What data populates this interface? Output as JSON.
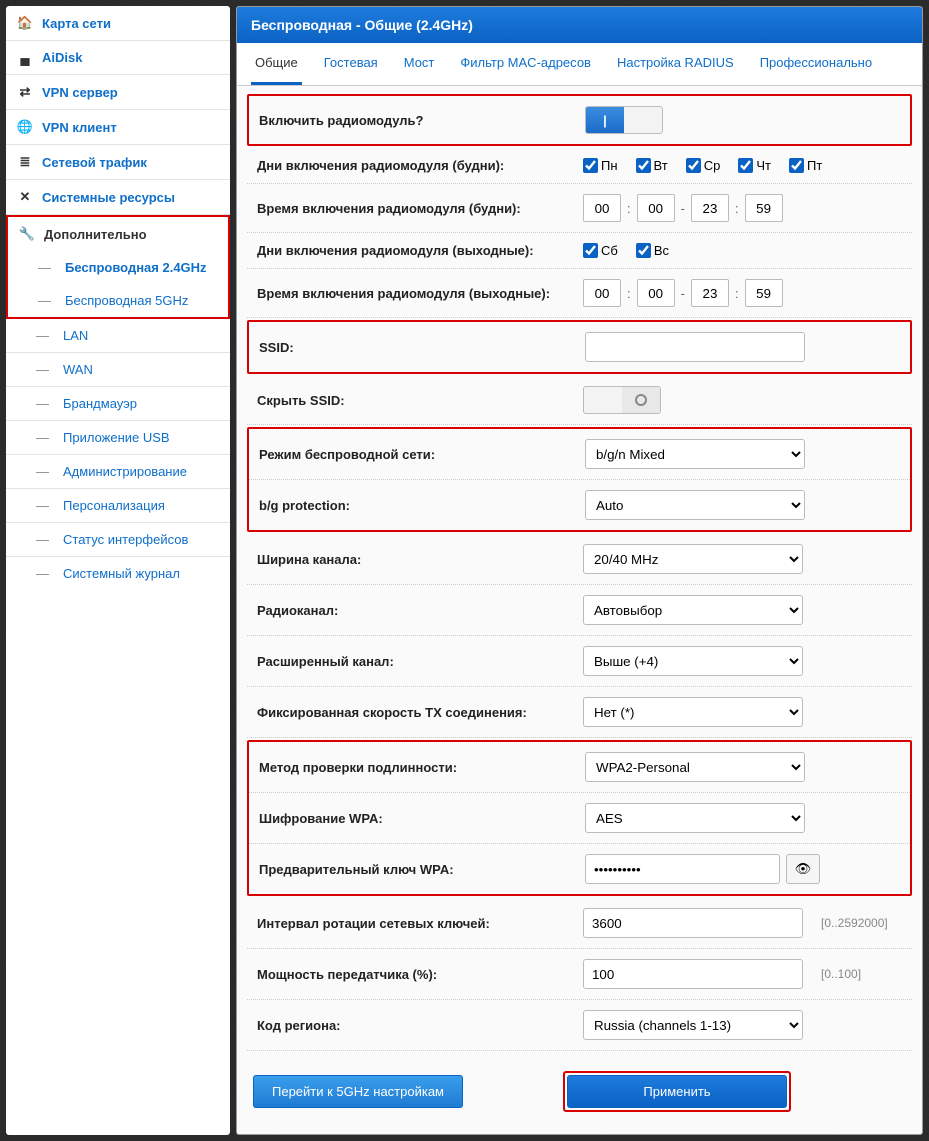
{
  "sidebar": {
    "items": [
      {
        "icon": "🏠",
        "label": "Карта сети",
        "dark": false
      },
      {
        "icon": "▄",
        "label": "AiDisk",
        "dark": false
      },
      {
        "icon": "⇄",
        "label": "VPN сервер",
        "dark": false
      },
      {
        "icon": "🌐",
        "label": "VPN клиент",
        "dark": false
      },
      {
        "icon": "≣",
        "label": "Сетевой трафик",
        "dark": false
      },
      {
        "icon": "✕",
        "label": "Системные ресурсы",
        "dark": false
      },
      {
        "icon": "🔧",
        "label": "Дополнительно",
        "dark": true
      }
    ],
    "subs": [
      {
        "label": "Беспроводная 2.4GHz",
        "bold": true
      },
      {
        "label": "Беспроводная 5GHz",
        "bold": false
      },
      {
        "label": "LAN",
        "bold": false
      },
      {
        "label": "WAN",
        "bold": false
      },
      {
        "label": "Брандмауэр",
        "bold": false
      },
      {
        "label": "Приложение USB",
        "bold": false
      },
      {
        "label": "Администрирование",
        "bold": false
      },
      {
        "label": "Персонализация",
        "bold": false
      },
      {
        "label": "Статус интерфейсов",
        "bold": false
      },
      {
        "label": "Системный журнал",
        "bold": false
      }
    ]
  },
  "header": {
    "title": "Беспроводная - Общие (2.4GHz)"
  },
  "tabs": [
    "Общие",
    "Гостевая",
    "Мост",
    "Фильтр MAC-адресов",
    "Настройка RADIUS",
    "Профессионально"
  ],
  "fields": {
    "enable_radio": "Включить радиомодуль?",
    "days_weekday": "Дни включения радиомодуля (будни):",
    "time_weekday": "Время включения радиомодуля (будни):",
    "days_weekend": "Дни включения радиомодуля (выходные):",
    "time_weekend": "Время включения радиомодуля (выходные):",
    "ssid": "SSID:",
    "hide_ssid": "Скрыть SSID:",
    "mode": "Режим беспроводной сети:",
    "bg_protection": "b/g protection:",
    "channel_width": "Ширина канала:",
    "radio_channel": "Радиоканал:",
    "ext_channel": "Расширенный канал:",
    "tx_rate": "Фиксированная скорость TX соединения:",
    "auth": "Метод проверки подлинности:",
    "wpa_enc": "Шифрование WPA:",
    "wpa_psk": "Предварительный ключ WPA:",
    "rekey": "Интервал ротации сетевых ключей:",
    "tx_power": "Мощность передатчика (%):",
    "region": "Код региона:"
  },
  "values": {
    "wk_days": [
      "Пн",
      "Вт",
      "Ср",
      "Чт",
      "Пт"
    ],
    "we_days": [
      "Сб",
      "Вс"
    ],
    "wk_time": {
      "h1": "00",
      "m1": "00",
      "h2": "23",
      "m2": "59"
    },
    "we_time": {
      "h1": "00",
      "m1": "00",
      "h2": "23",
      "m2": "59"
    },
    "ssid": "",
    "mode": "b/g/n Mixed",
    "bg_protection": "Auto",
    "channel_width": "20/40 MHz",
    "radio_channel": "Автовыбор",
    "ext_channel": "Выше (+4)",
    "tx_rate": "Нет (*)",
    "auth": "WPA2-Personal",
    "wpa_enc": "AES",
    "wpa_psk": "••••••••••",
    "rekey": "3600",
    "rekey_hint": "[0..2592000]",
    "tx_power": "100",
    "tx_power_hint": "[0..100]",
    "region": "Russia (channels 1-13)"
  },
  "buttons": {
    "goto5": "Перейти к 5GHz настройкам",
    "apply": "Применить"
  },
  "toggle": {
    "on_glyph": "|"
  }
}
